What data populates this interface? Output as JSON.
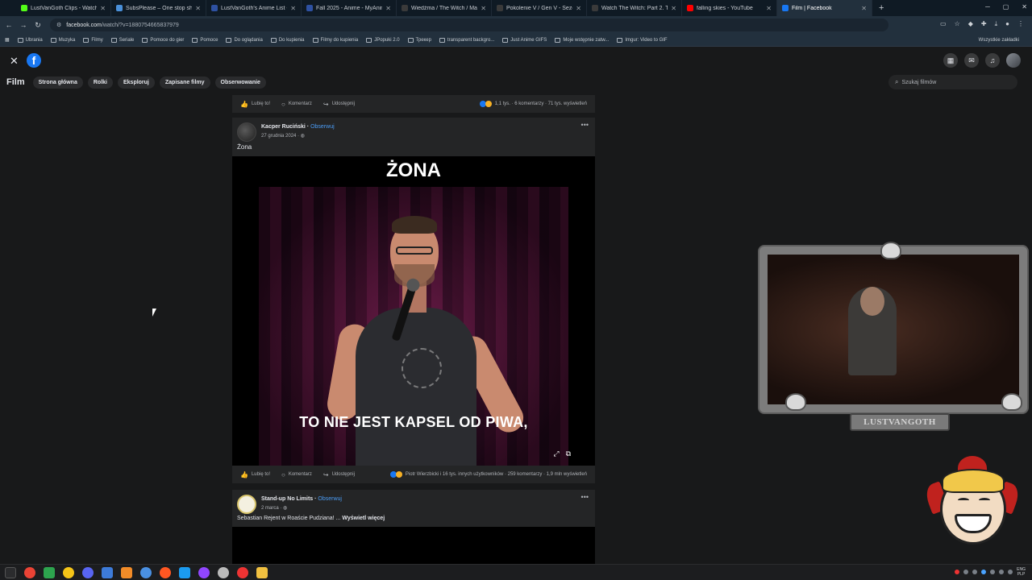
{
  "browser": {
    "tabs": [
      {
        "title": "LustVanGoth Clips - Watch Live",
        "color": "#53fc18"
      },
      {
        "title": "SubsPlease – One stop shop fo",
        "color": "#4a90d9"
      },
      {
        "title": "LustVanGoth's Anime List - My",
        "color": "#2e51a2"
      },
      {
        "title": "Fall 2025 - Anime - MyAnimeL",
        "color": "#2e51a2"
      },
      {
        "title": "Wiedźma / The Witch / Ma-nyc",
        "color": "#3a3a3a"
      },
      {
        "title": "Pokolenie V / Gen V - Sezon 2",
        "color": "#3a3a3a"
      },
      {
        "title": "Watch The Witch: Part 2. The O",
        "color": "#3a3a3a"
      },
      {
        "title": "falling skies - YouTube",
        "color": "#ff0000"
      },
      {
        "title": "Film | Facebook",
        "color": "#1877f2"
      }
    ],
    "new_tab": "+",
    "url_host": "facebook.com",
    "url_path": "/watch/?v=1880754665837979",
    "bookmarks": [
      "Ubrania",
      "Muzyka",
      "Filmy",
      "Seriale",
      "Pomoce do gier",
      "Pomoce",
      "Do oglądania",
      "Do kupienia",
      "Filmy do kupienia",
      "JPopuki 2.0",
      "Трекер",
      "transparent backgro...",
      "Just Anime GIFS",
      "Moje wstępnie zatw...",
      "Imgur: Video to GIF"
    ],
    "bookmarks_all": "Wszystkie zakładki"
  },
  "facebook": {
    "logo": "f",
    "nav_title": "Film",
    "nav_pills": [
      "Strona główna",
      "Rolki",
      "Eksploruj",
      "Zapisane filmy",
      "Obserwowanie"
    ],
    "search_placeholder": "Szukaj filmów"
  },
  "feed": {
    "top_actions": {
      "like": "Lubię to!",
      "comment": "Komentarz",
      "share": "Udostępnij",
      "stats": "1,1 tys. · 6 komentarzy · 71 tys. wyświetleń"
    },
    "post1": {
      "author": "Kacper Ruciński",
      "follow": "Obserwuj",
      "date": "27 grudnia 2024 ·",
      "caption": "Żona",
      "video_title": "ŻONA",
      "subtitle": "TO NIE JEST KAPSEL OD PIWA,",
      "actions": {
        "like": "Lubię to!",
        "comment": "Komentarz",
        "share": "Udostępnij",
        "stats": "Piotr Wierzbicki i 16 tys. innych użytkowników · 259 komentarzy · 1,9 mln wyświetleń"
      }
    },
    "post2": {
      "author": "Stand-up No Limits",
      "follow": "Obserwuj",
      "date": "2 marca ·",
      "caption": "Sebastian Rejent w Roaście Pudziana! ...",
      "caption_more": "Wyświetl więcej"
    }
  },
  "overlay": {
    "streamer_name": "LUSTVANGOTH"
  },
  "taskbar": {
    "lang_top": "ENG",
    "lang_bottom": "PLP"
  }
}
